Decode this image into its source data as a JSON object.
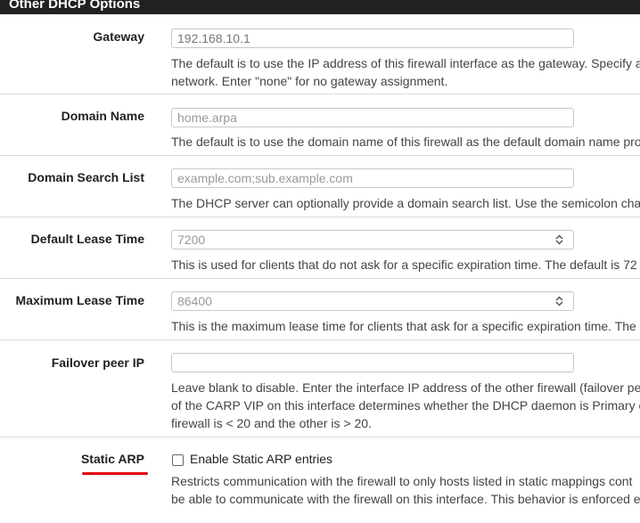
{
  "panel": {
    "title": "Other DHCP Options"
  },
  "gateway": {
    "label": "Gateway",
    "value": "192.168.10.1",
    "help1": "The default is to use the IP address of this firewall interface as the gateway. Specify a",
    "help2": "network. Enter \"none\" for no gateway assignment."
  },
  "domain_name": {
    "label": "Domain Name",
    "placeholder": "home.arpa",
    "help1": "The default is to use the domain name of this firewall as the default domain name pro"
  },
  "domain_search": {
    "label": "Domain Search List",
    "placeholder": "example.com;sub.example.com",
    "help1": "The DHCP server can optionally provide a domain search list. Use the semicolon char"
  },
  "default_lease": {
    "label": "Default Lease Time",
    "placeholder": "7200",
    "help1": "This is used for clients that do not ask for a specific expiration time. The default is 72"
  },
  "max_lease": {
    "label": "Maximum Lease Time",
    "placeholder": "86400",
    "help1": "This is the maximum lease time for clients that ask for a specific expiration time. The"
  },
  "failover": {
    "label": "Failover peer IP",
    "value": "",
    "help1": "Leave blank to disable. Enter the interface IP address of the other firewall (failover pe",
    "help2": "of the CARP VIP on this interface determines whether the DHCP daemon is Primary o",
    "help3": "firewall is < 20 and the other is > 20."
  },
  "static_arp": {
    "label": "Static ARP",
    "checkbox_label": "Enable Static ARP entries",
    "checked": false,
    "help1": "Restricts communication with the firewall to only hosts listed in static mappings cont",
    "help2": "be able to communicate with the firewall on this interface. This behavior is enforced e"
  },
  "colors": {
    "header_bg": "#212121",
    "highlight": "#e3000f"
  }
}
